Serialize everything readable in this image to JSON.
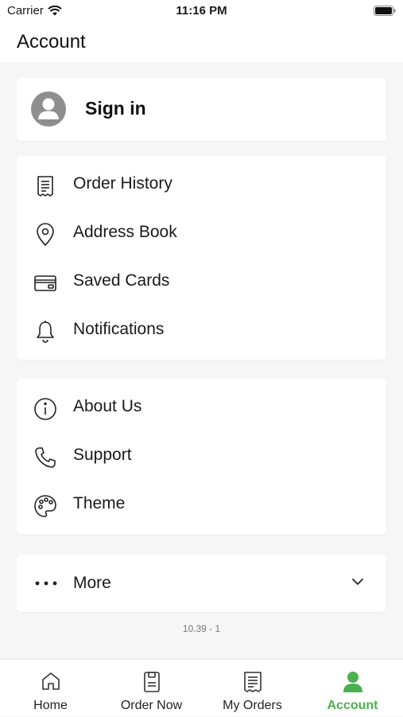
{
  "status_bar": {
    "carrier": "Carrier",
    "time": "11:16 PM"
  },
  "header": {
    "title": "Account"
  },
  "signin": {
    "label": "Sign in",
    "icon": "user-avatar-icon"
  },
  "menu_group_1": [
    {
      "label": "Order History",
      "icon": "receipt-icon"
    },
    {
      "label": "Address Book",
      "icon": "location-pin-icon"
    },
    {
      "label": "Saved Cards",
      "icon": "credit-card-icon"
    },
    {
      "label": "Notifications",
      "icon": "bell-icon"
    }
  ],
  "menu_group_2": [
    {
      "label": "About Us",
      "icon": "info-icon"
    },
    {
      "label": "Support",
      "icon": "phone-icon"
    },
    {
      "label": "Theme",
      "icon": "palette-icon"
    }
  ],
  "more": {
    "label": "More",
    "icon": "more-dots-icon"
  },
  "version": "10.39 - 1",
  "tabs": [
    {
      "label": "Home",
      "icon": "home-icon"
    },
    {
      "label": "Order Now",
      "icon": "order-now-icon"
    },
    {
      "label": "My Orders",
      "icon": "orders-list-icon"
    },
    {
      "label": "Account",
      "icon": "account-icon"
    }
  ],
  "colors": {
    "accent": "#4caf50",
    "background": "#f6f6f6",
    "card": "#ffffff",
    "avatar": "#8e8e8e"
  }
}
